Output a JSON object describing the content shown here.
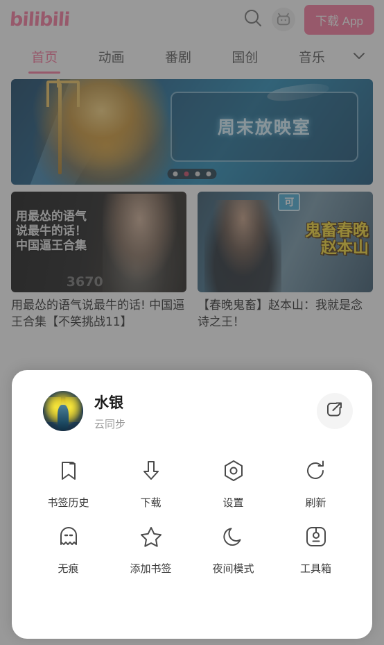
{
  "header": {
    "logo_text": "bilibili",
    "search_icon": "search-icon",
    "mascot_icon": "bilibili-mascot-avatar-icon",
    "download_app_label": "下载 App"
  },
  "nav": {
    "tabs": [
      {
        "label": "首页",
        "active": true
      },
      {
        "label": "动画",
        "active": false
      },
      {
        "label": "番剧",
        "active": false
      },
      {
        "label": "国创",
        "active": false
      },
      {
        "label": "音乐",
        "active": false
      }
    ],
    "more_icon": "chevron-down-icon"
  },
  "banner": {
    "overlay_text": "周末放映室",
    "dots_total": 4,
    "dot_active_index": 1
  },
  "cards": [
    {
      "thumb_overlay_lines": [
        "用最怂的语气",
        "说最牛的话！",
        "中国逼王合集"
      ],
      "thumb_watermark": "3670",
      "title": "用最怂的语气说最牛的话! 中国逼王合集【不笑挑战11】"
    },
    {
      "badge": "可",
      "thumb_overlay_lines": [
        "鬼畜春晚",
        "赵本山"
      ],
      "title": "【春晚鬼畜】赵本山：我就是念诗之王！"
    }
  ],
  "sheet": {
    "profile": {
      "name": "水银",
      "subtitle": "云同步",
      "avatar_icon": "user-avatar",
      "share_icon": "share-external-icon"
    },
    "grid": [
      [
        {
          "label": "书签历史",
          "icon": "bookmark-icon"
        },
        {
          "label": "下载",
          "icon": "download-arrow-icon"
        },
        {
          "label": "设置",
          "icon": "settings-hexagon-icon"
        },
        {
          "label": "刷新",
          "icon": "refresh-icon"
        }
      ],
      [
        {
          "label": "无痕",
          "icon": "incognito-ghost-icon"
        },
        {
          "label": "添加书签",
          "icon": "star-icon"
        },
        {
          "label": "夜间模式",
          "icon": "moon-icon"
        },
        {
          "label": "工具箱",
          "icon": "toolbox-icon"
        }
      ]
    ]
  },
  "colors": {
    "brand_pink": "#fb7299",
    "text_dark": "#1c1c1c",
    "icon_gray": "#4a4a4a",
    "dot_active": "#c8415f"
  }
}
